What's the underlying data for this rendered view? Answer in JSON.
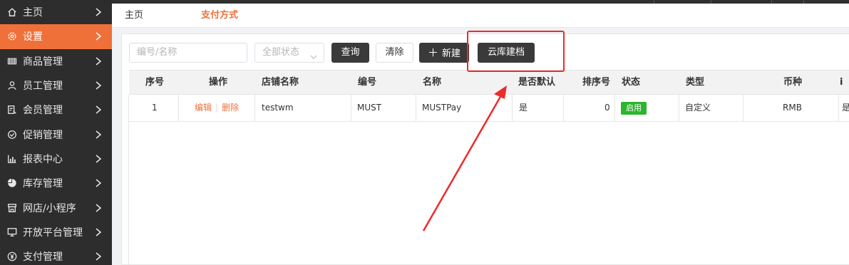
{
  "sidebar": {
    "items": [
      {
        "label": "主页",
        "icon": "home-icon",
        "active": false
      },
      {
        "label": "设置",
        "icon": "gear-icon",
        "active": true
      },
      {
        "label": "商品管理",
        "icon": "barcode-icon",
        "active": false
      },
      {
        "label": "员工管理",
        "icon": "user-icon",
        "active": false
      },
      {
        "label": "会员管理",
        "icon": "member-card-icon",
        "active": false
      },
      {
        "label": "促销管理",
        "icon": "check-circle-icon",
        "active": false
      },
      {
        "label": "报表中心",
        "icon": "bar-chart-icon",
        "active": false
      },
      {
        "label": "库存管理",
        "icon": "pie-chart-icon",
        "active": false
      },
      {
        "label": "网店/小程序",
        "icon": "shop-icon",
        "active": false
      },
      {
        "label": "开放平台管理",
        "icon": "monitor-icon",
        "active": false
      },
      {
        "label": "支付管理",
        "icon": "yuan-icon",
        "active": false
      }
    ]
  },
  "breadcrumb": {
    "home": "主页",
    "current": "支付方式"
  },
  "toolbar": {
    "search_placeholder": "编号/名称",
    "status_select": "全部状态",
    "query_label": "查询",
    "clear_label": "清除",
    "new_label": "新建",
    "cloud_label": "云库建档"
  },
  "table": {
    "headers": [
      "序号",
      "操作",
      "店铺名称",
      "编号",
      "名称",
      "是否默认",
      "排序号",
      "状态",
      "类型",
      "币种",
      "i"
    ],
    "rows": [
      {
        "index": "1",
        "edit": "编辑",
        "delete": "删除",
        "store": "testwm",
        "code": "MUST",
        "name": "MUSTPay",
        "is_default": "是",
        "sort": "0",
        "status": "启用",
        "type": "自定义",
        "currency": "RMB",
        "extra": "是"
      }
    ]
  },
  "colors": {
    "accent": "#f0703a",
    "sidebar_bg": "#2d2d2d",
    "status_green": "#2db52d",
    "annotation_red": "#ee2a2a"
  }
}
